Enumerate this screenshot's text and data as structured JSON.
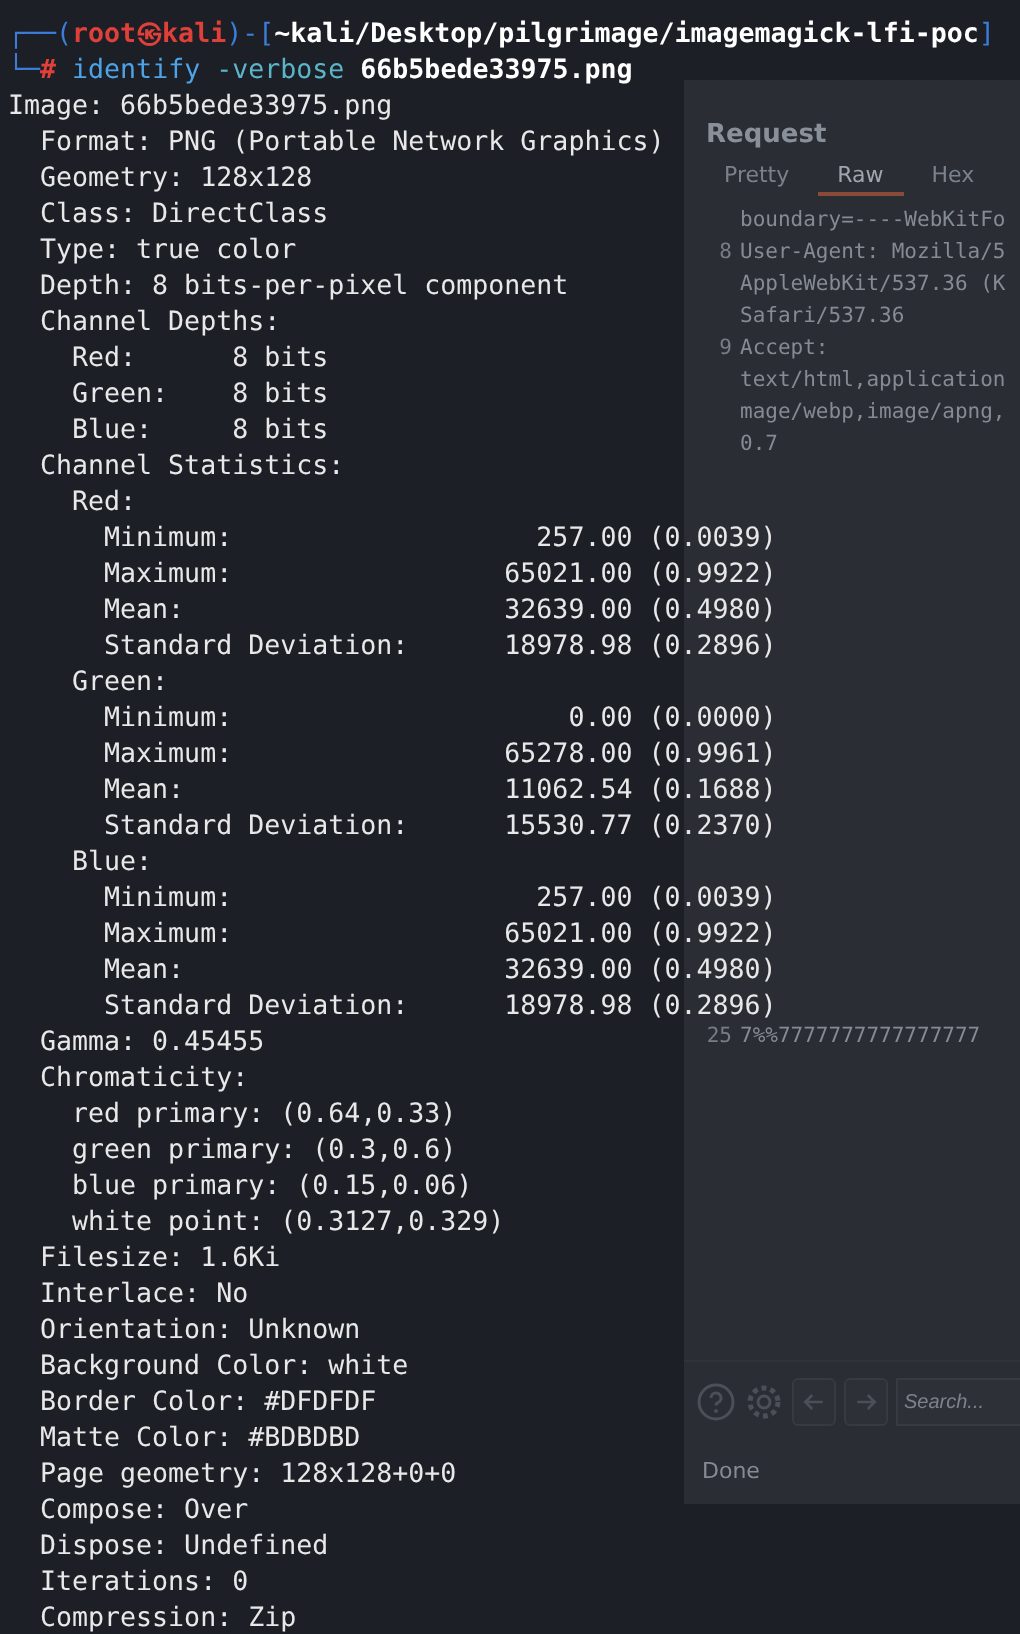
{
  "prompt_line": [
    {
      "kind": "frame",
      "text": "┌──("
    },
    {
      "kind": "user",
      "text": "root㉿kali"
    },
    {
      "kind": "frame",
      "text": ")-["
    },
    {
      "kind": "path",
      "text": "~kali/Desktop/pilgrimage/imagemagick-lfi-poc"
    },
    {
      "kind": "frame",
      "text": "]"
    }
  ],
  "command_line": [
    {
      "kind": "frame",
      "text": "└─"
    },
    {
      "kind": "user",
      "text": "#"
    },
    {
      "kind": "command",
      "text": " identify"
    },
    {
      "kind": "option",
      "text": " -verbose"
    },
    {
      "kind": "path",
      "text": " 66b5bede33975.png"
    }
  ],
  "output": [
    "Image: 66b5bede33975.png",
    "  Format: PNG (Portable Network Graphics)",
    "  Geometry: 128x128",
    "  Class: DirectClass",
    "  Type: true color",
    "  Depth: 8 bits-per-pixel component",
    "  Channel Depths:",
    "    Red:      8 bits",
    "    Green:    8 bits",
    "    Blue:     8 bits",
    "  Channel Statistics:",
    "    Red:",
    "      Minimum:                   257.00 (0.0039)",
    "      Maximum:                 65021.00 (0.9922)",
    "      Mean:                    32639.00 (0.4980)",
    "      Standard Deviation:      18978.98 (0.2896)",
    "    Green:",
    "      Minimum:                     0.00 (0.0000)",
    "      Maximum:                 65278.00 (0.9961)",
    "      Mean:                    11062.54 (0.1688)",
    "      Standard Deviation:      15530.77 (0.2370)",
    "    Blue:",
    "      Minimum:                   257.00 (0.0039)",
    "      Maximum:                 65021.00 (0.9922)",
    "      Mean:                    32639.00 (0.4980)",
    "      Standard Deviation:      18978.98 (0.2896)",
    "  Gamma: 0.45455",
    "  Chromaticity:",
    "    red primary: (0.64,0.33)",
    "    green primary: (0.3,0.6)",
    "    blue primary: (0.15,0.06)",
    "    white point: (0.3127,0.329)",
    "  Filesize: 1.6Ki",
    "  Interlace: No",
    "  Orientation: Unknown",
    "  Background Color: white",
    "  Border Color: #DFDFDF",
    "  Matte Color: #BDBDBD",
    "  Page geometry: 128x128+0+0",
    "  Compose: Over",
    "  Dispose: Undefined",
    "  Iterations: 0",
    "  Compression: Zip"
  ],
  "background_window": {
    "title": "Request",
    "tabs": [
      {
        "label": "Pretty",
        "selected": false
      },
      {
        "label": "Raw",
        "selected": true
      },
      {
        "label": "Hex",
        "selected": false
      }
    ],
    "lines_top": [
      {
        "text": "boundary=----WebKitFo"
      },
      {
        "number": "8",
        "text": "User-Agent: Mozilla/5"
      },
      {
        "text": "AppleWebKit/537.36 (K"
      },
      {
        "text": "Safari/537.36"
      },
      {
        "number": "9",
        "text": "Accept:"
      },
      {
        "text": "text/html,application"
      },
      {
        "text": "mage/webp,image/apng,"
      },
      {
        "text": "0.7"
      }
    ],
    "lines_bottom": [
      {
        "number": "25",
        "text": "7%%7777777777777777"
      }
    ],
    "search": {
      "placeholder": "Search..."
    },
    "status": "Done"
  }
}
